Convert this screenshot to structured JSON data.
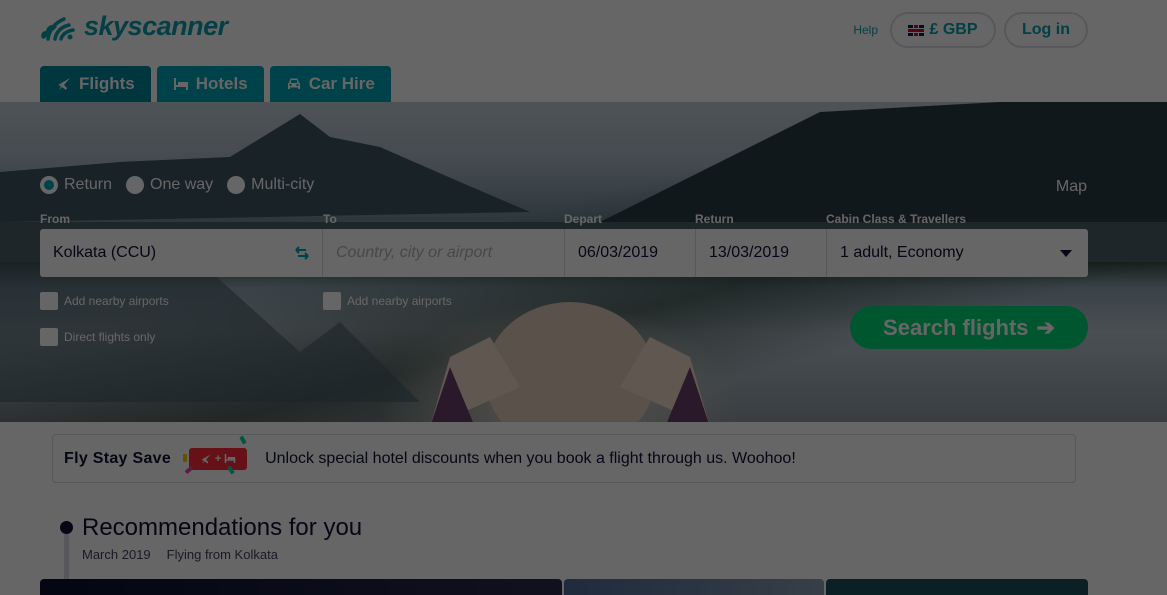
{
  "header": {
    "logo_text": "skyscanner",
    "help_label": "Help",
    "currency_label": "£ GBP",
    "currency_flag": "uk-flag-icon",
    "login_label": "Log in"
  },
  "tabs": [
    {
      "label": "Flights",
      "icon": "plane-icon",
      "active": true
    },
    {
      "label": "Hotels",
      "icon": "bed-icon",
      "active": false
    },
    {
      "label": "Car Hire",
      "icon": "car-icon",
      "active": false
    }
  ],
  "search": {
    "trip_types": [
      {
        "label": "Return",
        "checked": true
      },
      {
        "label": "One way",
        "checked": false
      },
      {
        "label": "Multi-city",
        "checked": false
      }
    ],
    "map_label": "Map",
    "labels": {
      "from": "From",
      "to": "To",
      "depart": "Depart",
      "return": "Return",
      "cabin": "Cabin Class & Travellers"
    },
    "from_value": "Kolkata (CCU)",
    "to_placeholder": "Country, city or airport",
    "depart_value": "06/03/2019",
    "return_value": "13/03/2019",
    "cabin_value": "1 adult, Economy",
    "from_nearby_label": "Add nearby airports",
    "to_nearby_label": "Add nearby airports",
    "direct_label": "Direct flights only",
    "search_button_label": "Search flights",
    "search_button_arrow": "➔"
  },
  "promo": {
    "title": "Fly Stay Save",
    "badge_plus": "+",
    "text": "Unlock special hotel discounts when you book a flight through us. Woohoo!"
  },
  "recommendations": {
    "title": "Recommendations for you",
    "month": "March 2019",
    "origin": "Flying from Kolkata"
  },
  "colors": {
    "brand": "#00a5b8",
    "brand_dark": "#00889a",
    "cta": "#00d775",
    "promo_badge": "#ff2b3a",
    "overlay": "rgba(0,0,0,0.6)"
  }
}
